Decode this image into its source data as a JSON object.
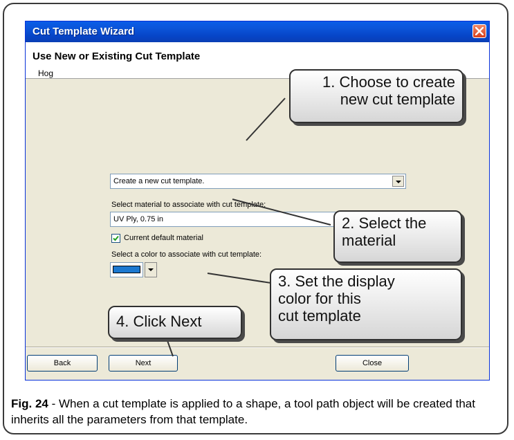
{
  "window": {
    "title": "Cut Template Wizard",
    "header_title": "Use New or Existing Cut Template",
    "header_sub": "Hog"
  },
  "form": {
    "template_choice": "Create a new cut template.",
    "material_label": "Select material to associate with cut template:",
    "material_value": "UV Ply, 0.75 in",
    "default_material_label": "Current default material",
    "default_material_checked": true,
    "color_label": "Select a color to associate with cut template:",
    "color_value": "#1b78d0"
  },
  "buttons": {
    "back": "Back",
    "next": "Next",
    "close": "Close"
  },
  "callouts": {
    "c1_line1": "1. Choose to create",
    "c1_line2": "new cut template",
    "c2_line1": "2. Select the",
    "c2_line2": "material",
    "c3_line1": "3. Set the display",
    "c3_line2": "color for this",
    "c3_line3": "cut template",
    "c4": "4. Click Next"
  },
  "caption": {
    "label": "Fig. 24",
    "text": " - When a cut template is applied to a shape, a tool path object will be created that inherits all the parameters from that template."
  },
  "icons": {
    "close": "close-icon",
    "dropdown": "chevron-down-icon",
    "check": "checkmark-icon"
  }
}
